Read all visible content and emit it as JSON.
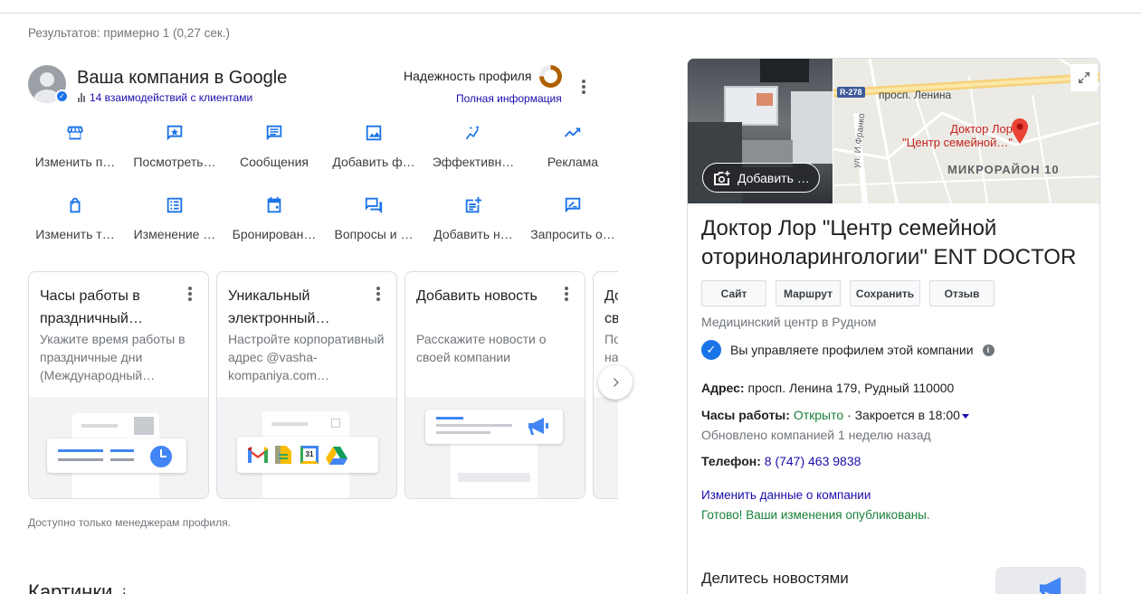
{
  "results_stats": "Результатов: примерно 1 (0,27 сек.)",
  "business_profile": {
    "title": "Ваша компания в Google",
    "interactions": "14 взаимодействий с клиентами",
    "reliability_label": "Надежность профиля",
    "reliability_fraction": 0.75,
    "full_info": "Полная информация",
    "actions": [
      {
        "label": "Изменить п…",
        "icon": "store-icon"
      },
      {
        "label": "Посмотреть…",
        "icon": "star-message-icon"
      },
      {
        "label": "Сообщения",
        "icon": "chat-icon"
      },
      {
        "label": "Добавить ф…",
        "icon": "image-icon"
      },
      {
        "label": "Эффективн…",
        "icon": "insights-icon"
      },
      {
        "label": "Реклама",
        "icon": "trending-up-icon"
      },
      {
        "label": "Изменить т…",
        "icon": "shopping-bag-icon"
      },
      {
        "label": "Изменение …",
        "icon": "list-icon"
      },
      {
        "label": "Бронирован…",
        "icon": "calendar-icon"
      },
      {
        "label": "Вопросы и …",
        "icon": "forum-icon"
      },
      {
        "label": "Добавить н…",
        "icon": "post-add-icon"
      },
      {
        "label": "Запросить о…",
        "icon": "rate-review-icon"
      }
    ],
    "cards": [
      {
        "title": "Часы работы в праздничный…",
        "desc": "Укажите время работы в праздничные дни (Международный…"
      },
      {
        "title": "Уникальный электронный…",
        "desc": "Настройте корпоративный адрес @vasha-kompaniya.com…"
      },
      {
        "title": "Добавить новость",
        "desc": "Расскажите новости о своей компании"
      },
      {
        "title": "До… св…",
        "desc": "По… на…"
      }
    ],
    "calendar_day": "31",
    "note": "Доступно только менеджерам профиля."
  },
  "images_heading": "Картинки",
  "knowledge_panel": {
    "add_photo": "Добавить …",
    "map": {
      "road_badge": "R-278",
      "street": "просп. Ленина",
      "pin_label_1": "Доктор Лор",
      "pin_label_2": "\"Центр семейной…\"",
      "district": "МИКРОРАЙОН 10",
      "side_street": "ул. И.Франко"
    },
    "title": "Доктор Лор \"Центр семейной оториноларингологии\" ENT DOCTOR",
    "buttons": [
      "Сайт",
      "Маршрут",
      "Сохранить",
      "Отзыв"
    ],
    "category": "Медицинский центр в Рудном",
    "owner_text": "Вы управляете профилем этой компании",
    "address_label": "Адрес:",
    "address": "просп. Ленина 179, Рудный 110000",
    "hours_label": "Часы работы:",
    "hours_status": "Открыто",
    "hours_close": "· Закроется в 18:00",
    "updated": "Обновлено компанией 1 неделю назад",
    "phone_label": "Телефон:",
    "phone": "8 (747) 463 9838",
    "edit_link": "Изменить данные о компании",
    "published": "Готово! Ваши изменения опубликованы.",
    "share_heading": "Делитесь новостями"
  }
}
